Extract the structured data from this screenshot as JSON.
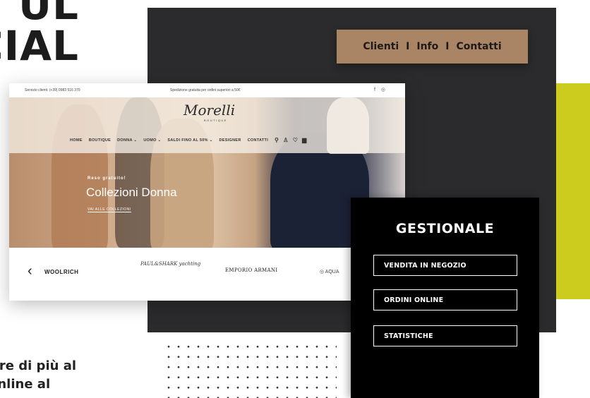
{
  "background": {
    "title_lines": [
      "UL",
      "CIAL"
    ],
    "text_lines": [
      "pre di più al",
      "online al"
    ]
  },
  "nav": {
    "items": [
      "Clienti",
      "Info",
      "Contatti"
    ],
    "separator": "I"
  },
  "site": {
    "topbar": {
      "left": "Servizio clienti: (+39) 0983 516 370",
      "center": "Spedizione gratuita per ordini superiori a 50€",
      "social": [
        "f",
        "◎"
      ]
    },
    "logo": "Morelli",
    "logo_sub": "BOUTIQUE",
    "menu": [
      "HOME",
      "BOUTIQUE",
      "DONNA ⌄",
      "UOMO ⌄",
      "SALDI FINO AL 50% ⌄",
      "DESIGNER",
      "CONTATTI"
    ],
    "hero": {
      "kicker": "Reso gratuito!",
      "title": "Collezioni Donna",
      "cta": "VAI ALLE COLLEZIONI"
    },
    "brands": {
      "arrow": "‹",
      "items": [
        "WOOLRICH",
        "PAUL&SHARK yachting",
        "EMPORIO ARMANI",
        "◎ AQUA"
      ]
    }
  },
  "gestionale": {
    "title": "GESTIONALE",
    "buttons": [
      "VENDITA IN NEGOZIO",
      "ORDINI ONLINE",
      "STATISTICHE"
    ]
  },
  "colors": {
    "dark_panel": "#2b2b2d",
    "nav_pill": "#a98566",
    "lime": "#cccc1f",
    "gest_bg": "#000000"
  }
}
